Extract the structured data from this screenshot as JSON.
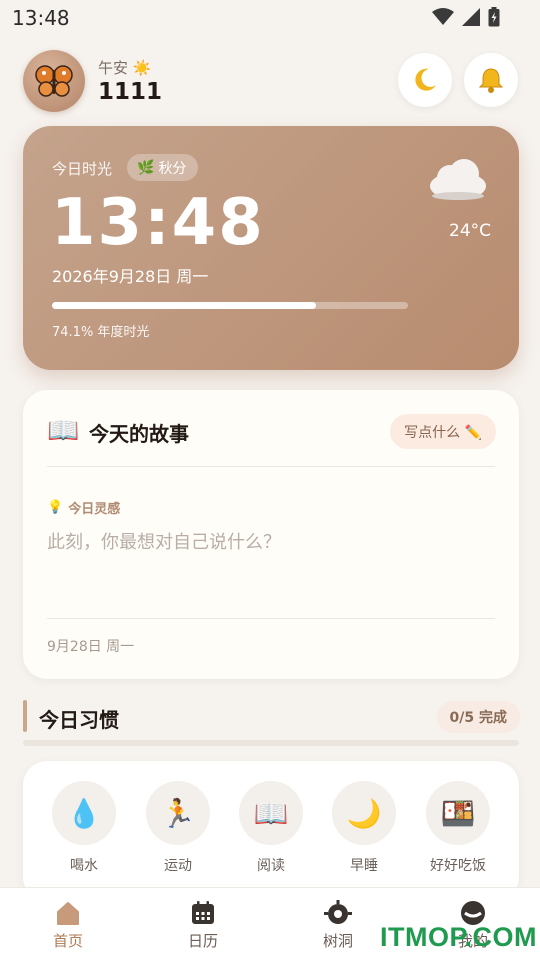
{
  "status_bar": {
    "time": "13:48",
    "icons": [
      "wifi-icon",
      "signal-icon",
      "battery-icon"
    ]
  },
  "header": {
    "greeting": "午安 ☀️",
    "username": "1111",
    "avatar_icon": "butterfly-icon",
    "buttons": [
      "moon-icon",
      "bell-icon"
    ]
  },
  "hero": {
    "label": "今日时光",
    "term": "秋分",
    "time": "13:48",
    "date": "2026年9月28日 周一",
    "year_progress": 0.741,
    "progress_text": "74.1% 年度时光",
    "temperature": "24°C",
    "weather_icon": "cloud-icon",
    "colors": {
      "card_start": "#c4a38c",
      "card_end": "#b88c6f"
    }
  },
  "story": {
    "title": "今天的故事",
    "write_label": "写点什么 ✏️",
    "inspiration_label": "今日灵感",
    "inspiration_text": "此刻，你最想对自己说什么？",
    "date": "9月28日 周一"
  },
  "habits": {
    "title": "今日习惯",
    "count": "0/5 完成",
    "items": [
      {
        "label": "喝水",
        "icon": "💧"
      },
      {
        "label": "运动",
        "icon": "🏃"
      },
      {
        "label": "阅读",
        "icon": "📖"
      },
      {
        "label": "早睡",
        "icon": "🌙"
      },
      {
        "label": "好好吃饭",
        "icon": "🍱"
      }
    ]
  },
  "nav": {
    "items": [
      {
        "label": "首页",
        "icon": "home-icon"
      },
      {
        "label": "日历",
        "icon": "calendar-icon"
      },
      {
        "label": "树洞",
        "icon": "tree-hole-icon"
      },
      {
        "label": "我的",
        "icon": "profile-icon"
      }
    ],
    "active": 0
  },
  "watermark": "ITMOP.COM"
}
